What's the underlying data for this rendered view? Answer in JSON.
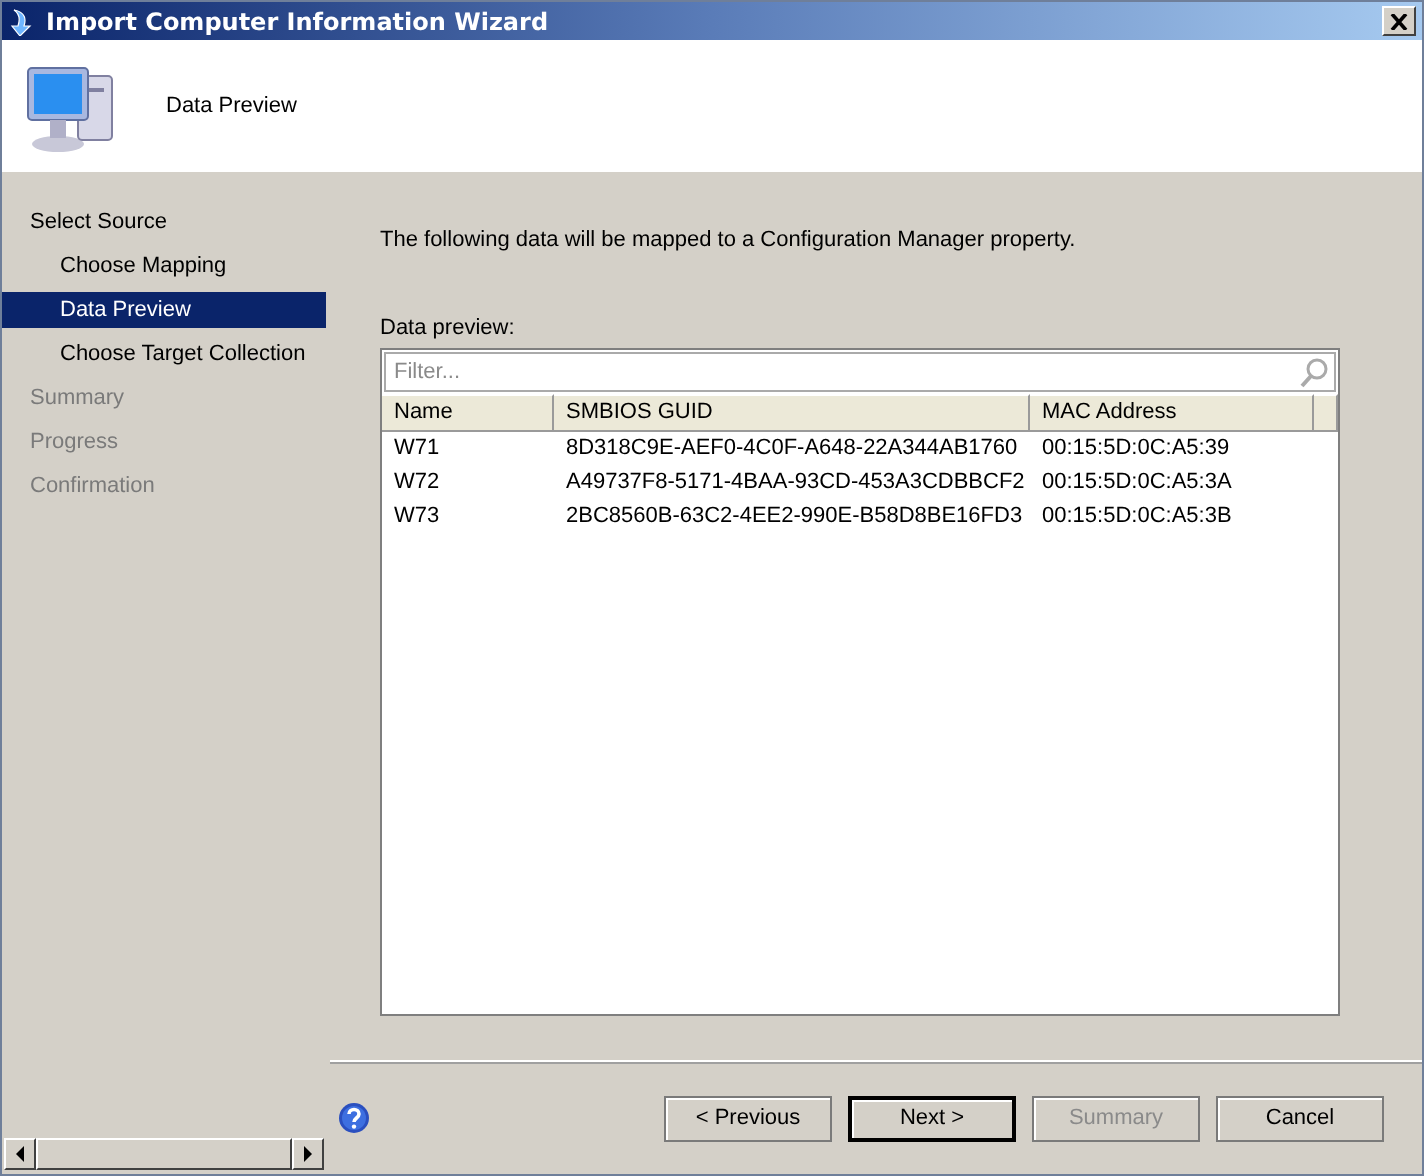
{
  "window": {
    "title": "Import Computer Information Wizard"
  },
  "header": {
    "title": "Data Preview"
  },
  "sidebar": {
    "items": [
      {
        "label": "Select Source",
        "selected": false,
        "disabled": false,
        "children": [
          {
            "label": "Choose Mapping",
            "selected": false,
            "disabled": false
          },
          {
            "label": "Data Preview",
            "selected": true,
            "disabled": false
          },
          {
            "label": "Choose Target Collection",
            "selected": false,
            "disabled": false
          }
        ]
      },
      {
        "label": "Summary",
        "selected": false,
        "disabled": true
      },
      {
        "label": "Progress",
        "selected": false,
        "disabled": true
      },
      {
        "label": "Confirmation",
        "selected": false,
        "disabled": true
      }
    ]
  },
  "content": {
    "description": "The following data will be mapped to a Configuration Manager property.",
    "preview_label": "Data preview:",
    "filter": {
      "placeholder": "Filter..."
    },
    "table": {
      "columns": [
        "Name",
        "SMBIOS GUID",
        "MAC Address"
      ],
      "rows": [
        [
          "W71",
          "8D318C9E-AEF0-4C0F-A648-22A344AB1760",
          "00:15:5D:0C:A5:39"
        ],
        [
          "W72",
          "A49737F8-5171-4BAA-93CD-453A3CDBBCF2",
          "00:15:5D:0C:A5:3A"
        ],
        [
          "W73",
          "2BC8560B-63C2-4EE2-990E-B58D8BE16FD3",
          "00:15:5D:0C:A5:3B"
        ]
      ]
    }
  },
  "buttons": [
    {
      "label": "< Previous",
      "default": false,
      "disabled": false
    },
    {
      "label": "Next >",
      "default": true,
      "disabled": false
    },
    {
      "label": "Summary",
      "default": false,
      "disabled": true
    },
    {
      "label": "Cancel",
      "default": false,
      "disabled": false
    }
  ]
}
